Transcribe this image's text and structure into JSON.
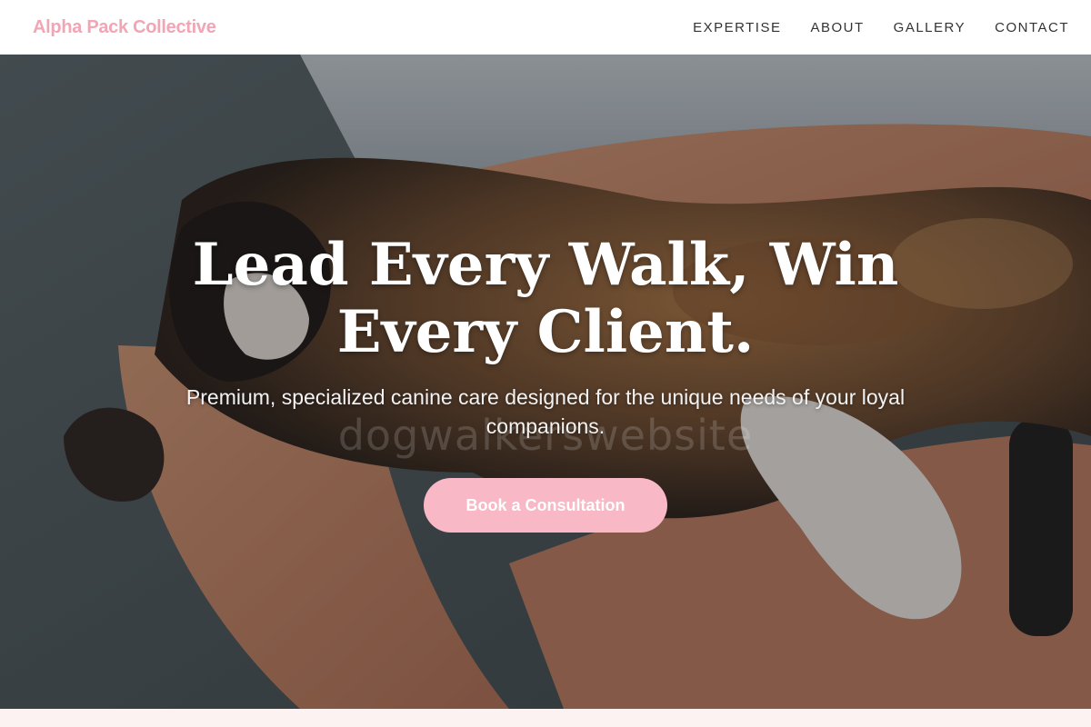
{
  "nav": {
    "brand": "Alpha Pack Collective",
    "links": [
      "EXPERTISE",
      "ABOUT",
      "GALLERY",
      "CONTACT"
    ]
  },
  "hero": {
    "title": "Lead Every Walk, Win Every Client.",
    "subtitle": "Premium, specialized canine care designed for the unique needs of your loyal companions.",
    "cta_label": "Book a Consultation",
    "watermark": "dogwalkerswebsite"
  },
  "colors": {
    "brand": "#f2a5b4",
    "cta_bg": "#f8b8c5",
    "nav_bg": "#ffffff",
    "nav_text": "#333333",
    "section_bg": "#fdf2f2"
  }
}
